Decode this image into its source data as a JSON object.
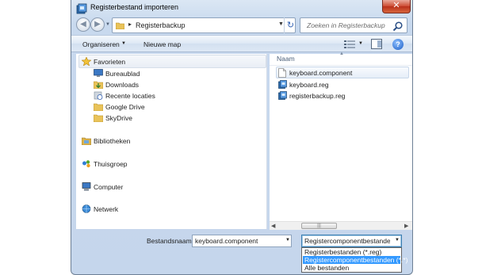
{
  "window": {
    "title": "Registerbestand importeren",
    "close_label": "✕"
  },
  "address": {
    "back_glyph": "◀",
    "forward_glyph": "▶",
    "separator": "▸",
    "path": "Registerbackup",
    "refresh_glyph": "↻"
  },
  "search": {
    "placeholder": "Zoeken in Registerbackup"
  },
  "toolbar": {
    "organize_label": "Organiseren",
    "new_folder_label": "Nieuwe map",
    "help_label": "?"
  },
  "nav": {
    "items": [
      {
        "label": "Favorieten",
        "icon": "star-icon"
      },
      {
        "label": "Bureaublad",
        "icon": "desktop-icon"
      },
      {
        "label": "Downloads",
        "icon": "downloads-icon"
      },
      {
        "label": "Recente locaties",
        "icon": "recent-places-icon"
      },
      {
        "label": "Google Drive",
        "icon": "folder-icon"
      },
      {
        "label": "SkyDrive",
        "icon": "folder-icon"
      },
      {
        "label": "Bibliotheken",
        "icon": "libraries-icon"
      },
      {
        "label": "Thuisgroep",
        "icon": "homegroup-icon"
      },
      {
        "label": "Computer",
        "icon": "computer-icon"
      },
      {
        "label": "Netwerk",
        "icon": "network-icon"
      }
    ]
  },
  "files": {
    "column_name": "Naam",
    "items": [
      {
        "name": "keyboard.component",
        "icon": "blank-file-icon",
        "selected": true
      },
      {
        "name": "keyboard.reg",
        "icon": "reg-file-icon",
        "selected": false
      },
      {
        "name": "registerbackup.reg",
        "icon": "reg-file-icon",
        "selected": false
      }
    ]
  },
  "bottom": {
    "filename_label": "Bestandsnaam:",
    "filename_value": "keyboard.component",
    "filetype_value": "Registercomponentbestanden (*.*)",
    "filetype_options": [
      "Registerbestanden (*.reg)",
      "Registercomponentbestanden (*.*)",
      "Alle bestanden"
    ],
    "selected_option_index": 1
  },
  "colors": {
    "selection": "#3399ff",
    "frame": "#c5d6ec"
  }
}
